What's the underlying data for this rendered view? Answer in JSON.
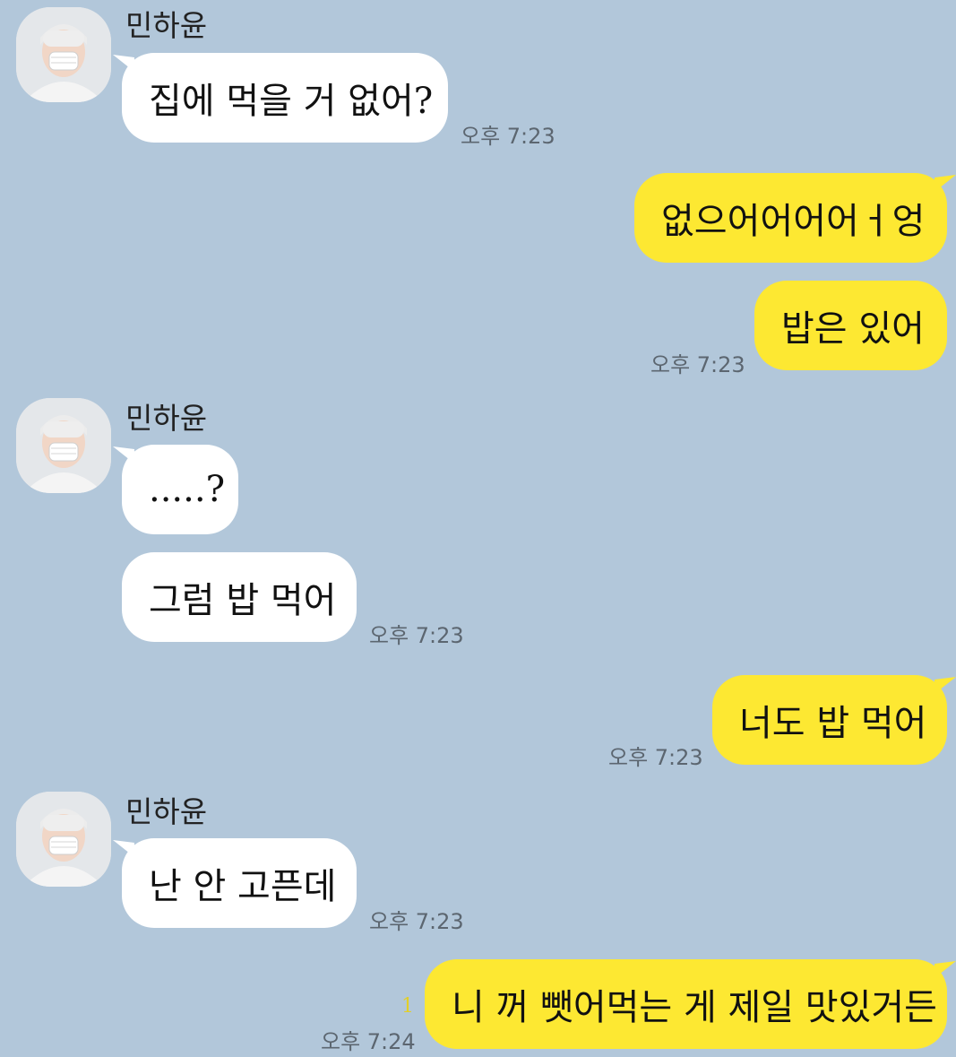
{
  "chat": {
    "sender_name": "민하윤",
    "messages": [
      {
        "text": "집에 먹을 거 없어?",
        "time": "오후 7:23"
      },
      {
        "text": "없으어어어어ㅓ엉"
      },
      {
        "text": "밥은 있어",
        "time": "오후 7:23"
      },
      {
        "text": ".....?"
      },
      {
        "text": "그럼 밥 먹어",
        "time": "오후 7:23"
      },
      {
        "text": "너도 밥 먹어",
        "time": "오후 7:23"
      },
      {
        "text": "난 안 고픈데",
        "time": "오후 7:23"
      },
      {
        "text": "니 꺼 뺏어먹는 게 제일 맛있거든",
        "time": "오후 7:24",
        "unread": "1"
      }
    ]
  },
  "colors": {
    "background": "#b2c7da",
    "incoming_bubble": "#ffffff",
    "outgoing_bubble": "#fde832"
  }
}
